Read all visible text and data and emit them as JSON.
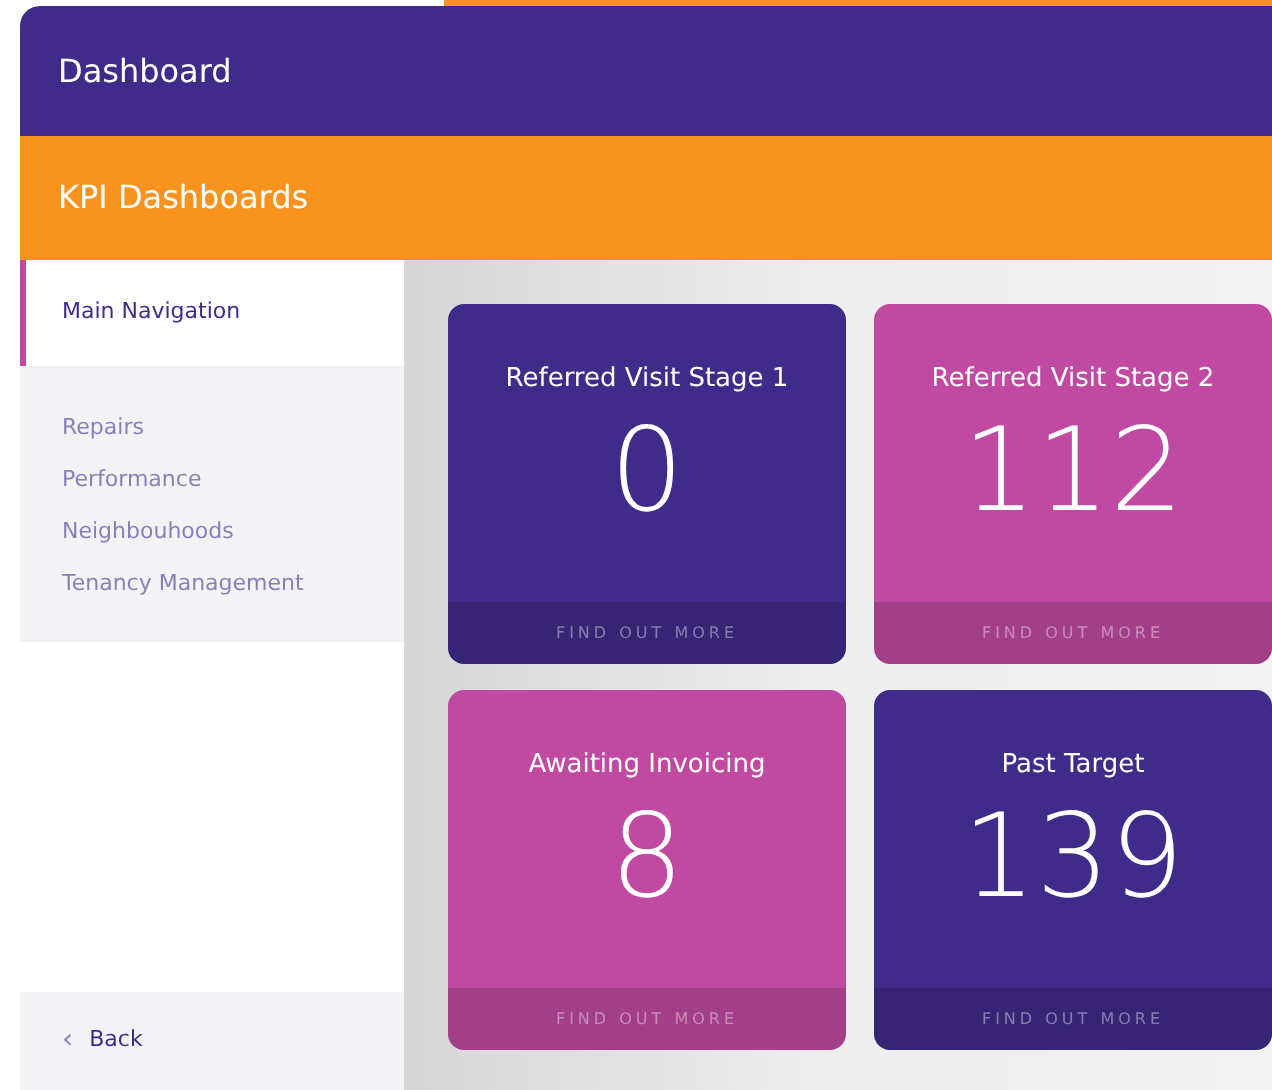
{
  "header": {
    "title": "Dashboard"
  },
  "subheader": {
    "title": "KPI Dashboards"
  },
  "sidebar": {
    "heading": "Main Navigation",
    "items": [
      {
        "label": "Repairs"
      },
      {
        "label": "Performance"
      },
      {
        "label": "Neighbouhoods"
      },
      {
        "label": "Tenancy Management"
      }
    ],
    "back": {
      "icon": "‹",
      "label": "Back"
    }
  },
  "cards": [
    {
      "title": "Referred Visit Stage 1",
      "value": "0",
      "link": "FIND OUT MORE",
      "color": "#412b8a"
    },
    {
      "title": "Referred Visit Stage 2",
      "value": "112",
      "link": "FIND OUT MORE",
      "color": "#c04aa2"
    },
    {
      "title": "Awaiting Invoicing",
      "value": "8",
      "link": "FIND OUT MORE",
      "color": "#c04aa2"
    },
    {
      "title": "Past Target",
      "value": "139",
      "link": "FIND OUT MORE",
      "color": "#412b8a"
    }
  ]
}
